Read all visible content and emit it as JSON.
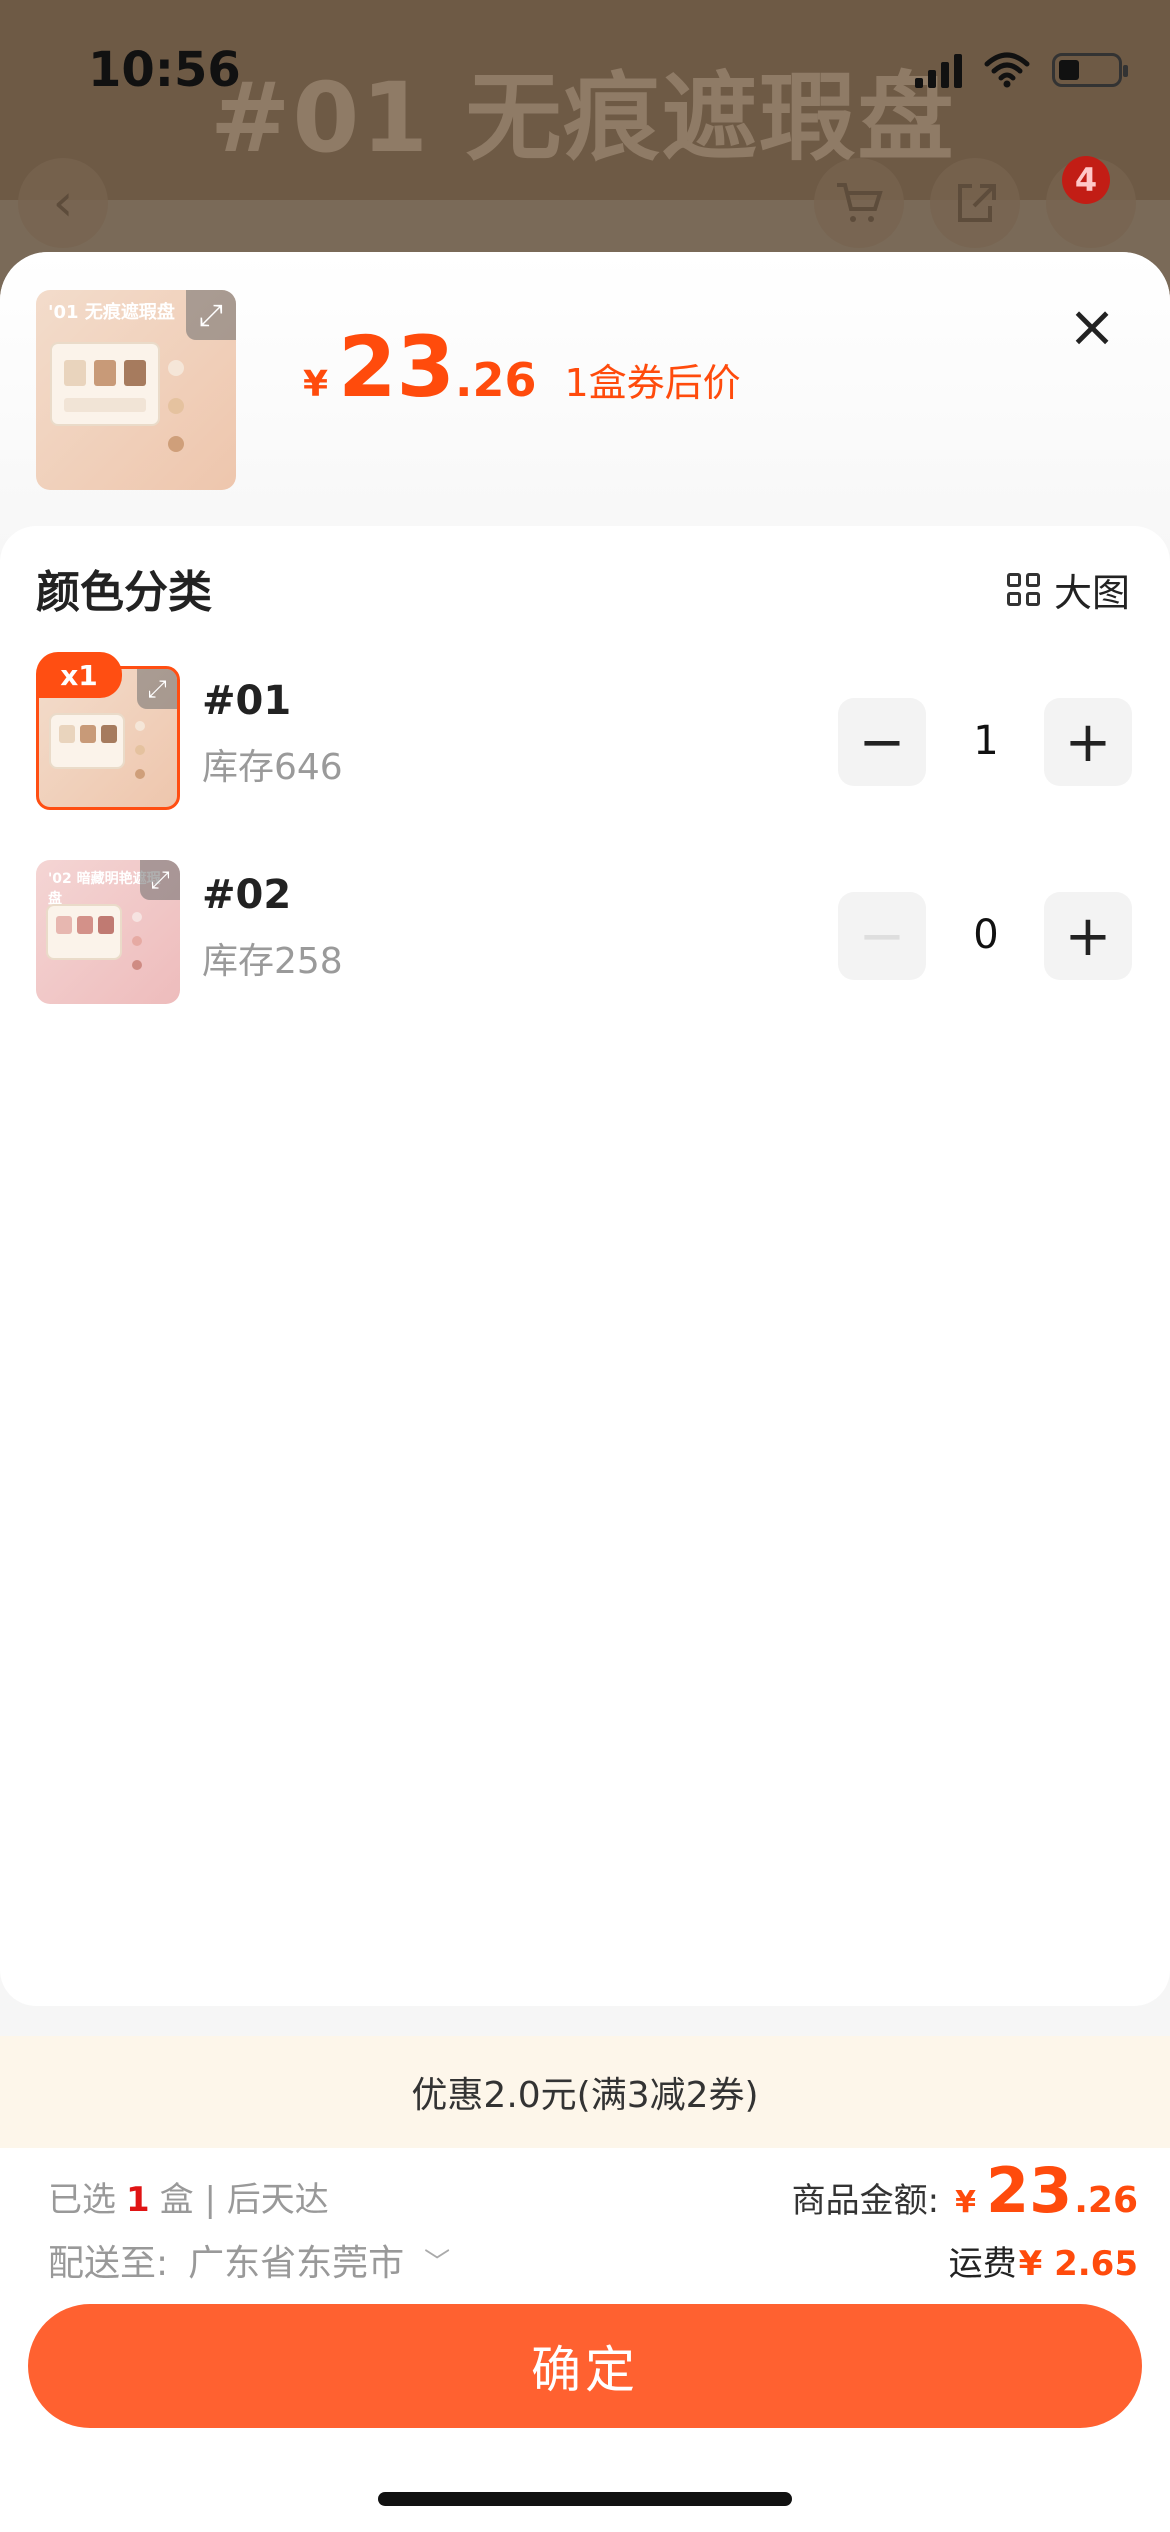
{
  "status_bar": {
    "time": "10:56"
  },
  "background_page": {
    "title": "#01 无痕遮瑕盘",
    "cart_badge": "4"
  },
  "header": {
    "thumbnail_caption": "'01 无痕遮瑕盘",
    "price_symbol": "¥",
    "price_int": "23",
    "price_dec": ".26",
    "price_note": "1盒券后价"
  },
  "section": {
    "title": "颜色分类",
    "big_image_label": "大图"
  },
  "skus": [
    {
      "name": "#01",
      "stock": "库存646",
      "qty": "1",
      "badge": "x1",
      "caption": "'01"
    },
    {
      "name": "#02",
      "stock": "库存258",
      "qty": "0",
      "badge": "",
      "caption": "'02 暗藏明艳遮瑕盘"
    }
  ],
  "promo": {
    "text": "优惠2.0元(满3减2券)"
  },
  "footer": {
    "selected_prefix": "已选",
    "selected_count": "1",
    "selected_suffix": "盒 | 后天达",
    "ship_label": "配送至:",
    "ship_value": "广东省东莞市",
    "total_label": "商品金额:",
    "total_symbol": "¥",
    "total_int": "23",
    "total_dec": ".26",
    "fee_label": "运费",
    "fee_value": "¥ 2.65",
    "confirm_label": "确定"
  },
  "colors": {
    "accent": "#ff4b0c",
    "button": "#ff6130",
    "promo_bg": "#fdf6ea"
  }
}
